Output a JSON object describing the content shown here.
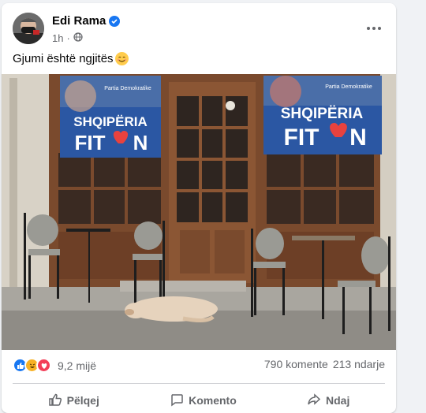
{
  "post": {
    "author": "Edi Rama",
    "time": "1h",
    "text": "Gjumi është ngjitës",
    "reaction_count": "9,2 mijë",
    "comments": "790 komente",
    "shares": "213 ndarje"
  },
  "photo": {
    "banner_brand": "Partia Demokratike",
    "banner_line1": "SHQIPËRIA",
    "banner_line2_a": "FIT",
    "banner_line2_b": "N"
  },
  "actions": {
    "like": "Pëlqej",
    "comment": "Komento",
    "share": "Ndaj"
  },
  "colors": {
    "verified": "#1877f2",
    "like": "#1877f2",
    "haha": "#f7b125",
    "love": "#f33e58",
    "banner_blue": "#2b57a3"
  }
}
